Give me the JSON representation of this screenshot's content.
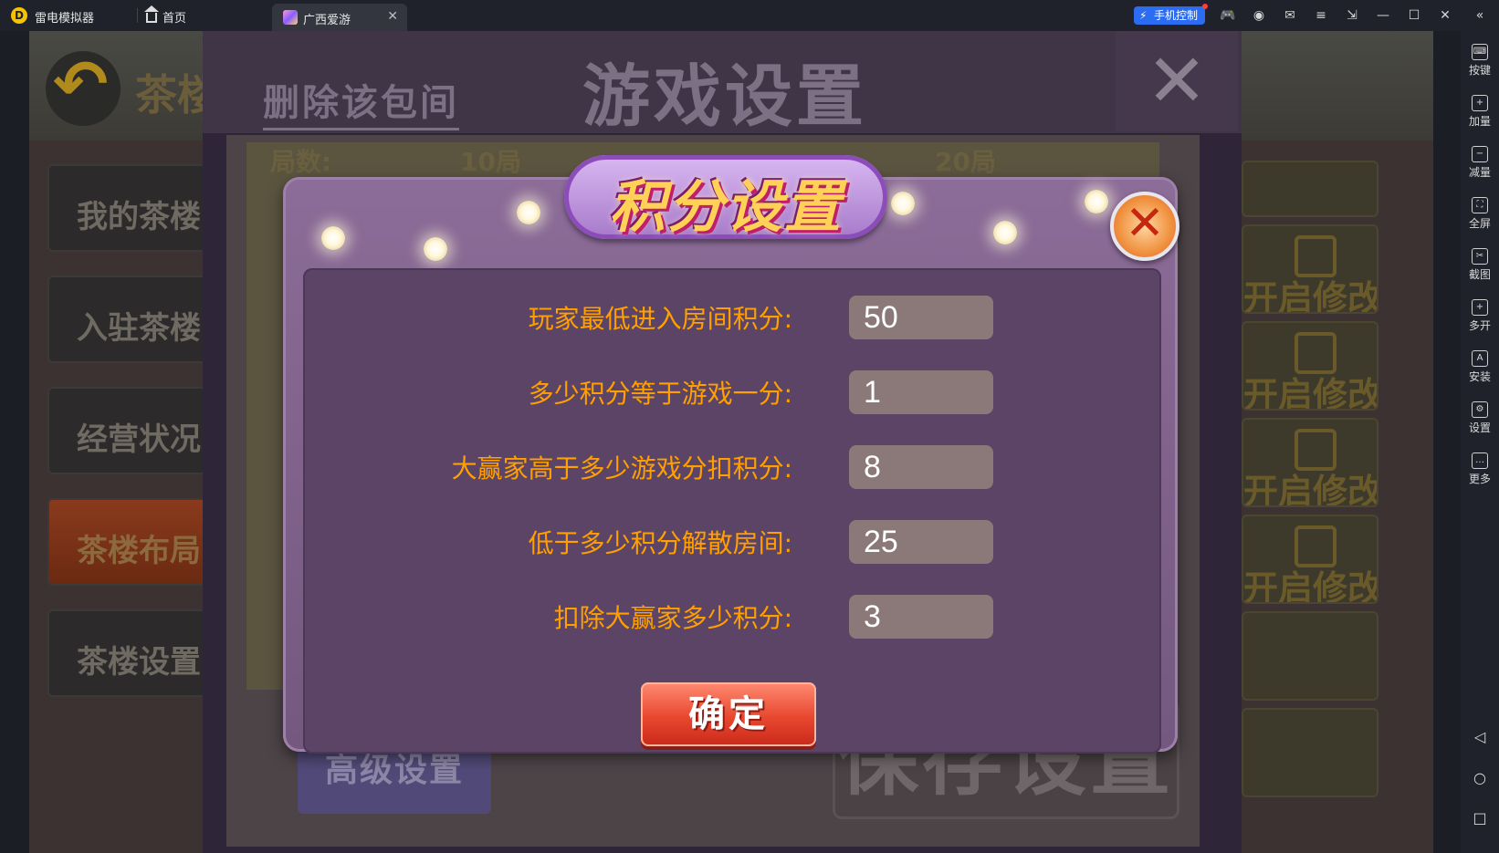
{
  "window": {
    "app_name": "雷电模拟器",
    "home_tab": "首页",
    "game_tab": "广西爱游",
    "phone_control": "手机控制"
  },
  "sidebar": {
    "items": [
      {
        "label": "按键",
        "icon": "keyboard-icon"
      },
      {
        "label": "加量",
        "icon": "volume-up-icon"
      },
      {
        "label": "减量",
        "icon": "volume-down-icon"
      },
      {
        "label": "全屏",
        "icon": "fullscreen-icon"
      },
      {
        "label": "截图",
        "icon": "scissors-icon"
      },
      {
        "label": "多开",
        "icon": "multi-instance-icon"
      },
      {
        "label": "安装",
        "icon": "apk-icon"
      },
      {
        "label": "设置",
        "icon": "gear-icon"
      },
      {
        "label": "更多",
        "icon": "more-icon"
      }
    ]
  },
  "background": {
    "title": "茶楼",
    "menu": [
      "我的茶楼",
      "入驻茶楼",
      "经营状况",
      "茶楼布局",
      "茶楼设置"
    ],
    "right_rows": [
      "开启修改",
      "开启修改",
      "开启修改",
      "开启修改"
    ]
  },
  "game_settings": {
    "title": "游戏设置",
    "delete_room": "删除该包间",
    "rows": [
      "局数:",
      "10局",
      "20局"
    ],
    "advanced": "高级设置",
    "save": "保存设置"
  },
  "score_dialog": {
    "title": "积分设置",
    "fields": [
      {
        "label": "玩家最低进入房间积分:",
        "value": "50"
      },
      {
        "label": "多少积分等于游戏一分:",
        "value": "1"
      },
      {
        "label": "大赢家高于多少游戏分扣积分:",
        "value": "8"
      },
      {
        "label": "低于多少积分解散房间:",
        "value": "25"
      },
      {
        "label": "扣除大赢家多少积分:",
        "value": "3"
      }
    ],
    "confirm": "确定"
  },
  "colors": {
    "label": "#ffa000",
    "input_bg": "#8b7878",
    "dialog_inner": "#5b4466",
    "accent_blue": "#2b6cf3"
  }
}
